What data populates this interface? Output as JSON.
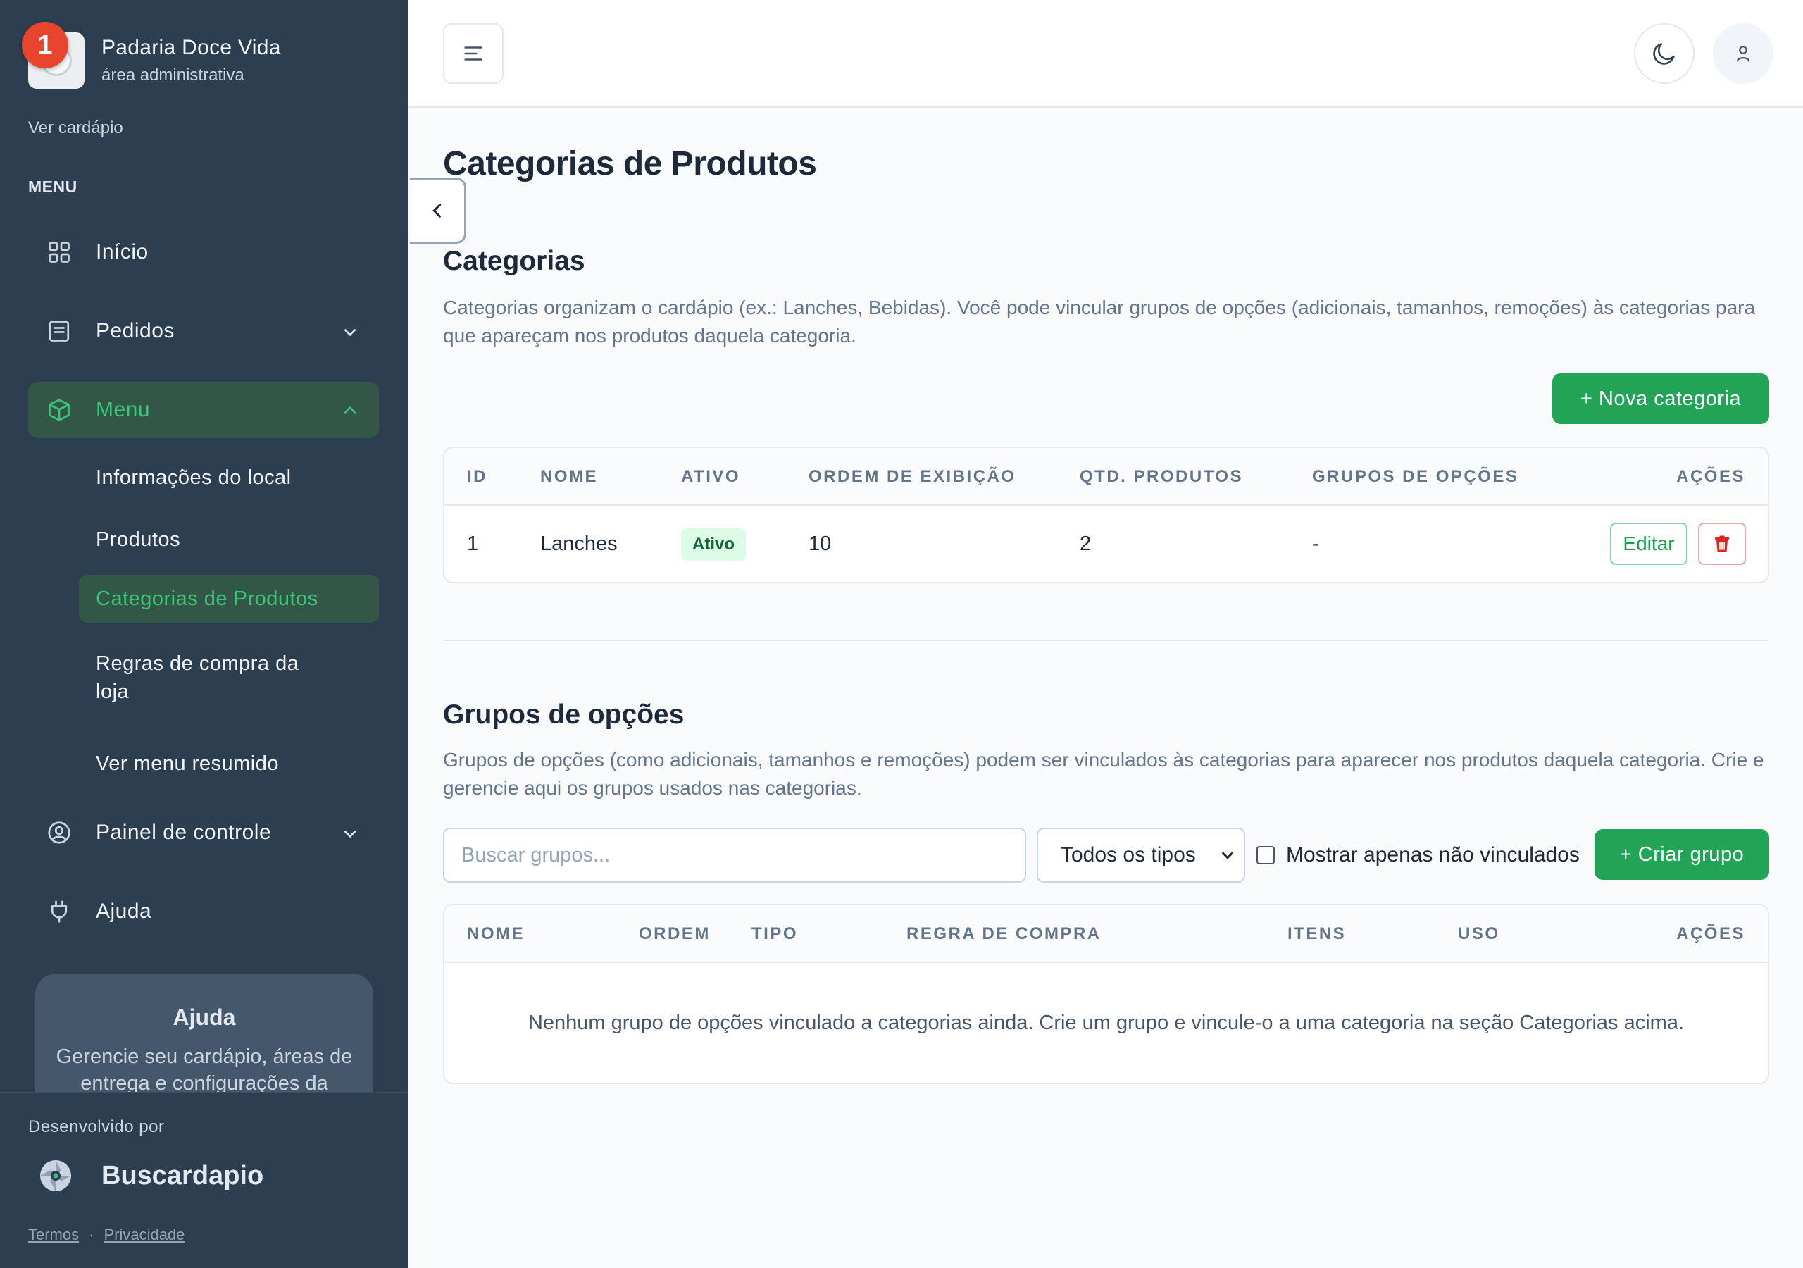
{
  "sidebar": {
    "brand": {
      "name": "Padaria Doce Vida",
      "subtitle": "área administrativa",
      "notification_count": "1"
    },
    "view_menu_link": "Ver cardápio",
    "menu_heading": "MENU",
    "nav": {
      "inicio": "Início",
      "pedidos": "Pedidos",
      "menu": "Menu",
      "painel": "Painel de controle",
      "ajuda": "Ajuda"
    },
    "menu_subitems": [
      "Informações do local",
      "Produtos",
      "Categorias de Produtos",
      "Regras de compra da loja",
      "Ver menu resumido"
    ],
    "help_card": {
      "title": "Ajuda",
      "text": "Gerencie seu cardápio, áreas de entrega e configurações da"
    },
    "developed_by": "Desenvolvido por",
    "developer_name": "Buscardapio",
    "footer": {
      "terms": "Termos",
      "separator": "·",
      "privacy": "Privacidade"
    }
  },
  "page": {
    "title": "Categorias de Produtos"
  },
  "categories": {
    "title": "Categorias",
    "description": "Categorias organizam o cardápio (ex.: Lanches, Bebidas). Você pode vincular grupos de opções (adicionais, tamanhos, remoções) às categorias para que apareçam nos produtos daquela categoria.",
    "new_button": "+ Nova categoria",
    "columns": [
      "ID",
      "NOME",
      "ATIVO",
      "ORDEM DE EXIBIÇÃO",
      "QTD. PRODUTOS",
      "GRUPOS DE OPÇÕES",
      "AÇÕES"
    ],
    "rows": [
      {
        "id": "1",
        "name": "Lanches",
        "status": "Ativo",
        "order": "10",
        "products": "2",
        "option_groups": "-",
        "edit_label": "Editar"
      }
    ]
  },
  "option_groups": {
    "title": "Grupos de opções",
    "description": "Grupos de opções (como adicionais, tamanhos e remoções) podem ser vinculados às categorias para aparecer nos produtos daquela categoria. Crie e gerencie aqui os grupos usados nas categorias.",
    "search_placeholder": "Buscar grupos...",
    "type_filter_selected": "Todos os tipos",
    "unlinked_only_label": "Mostrar apenas não vinculados",
    "unlinked_only_checked": false,
    "create_button": "+ Criar grupo",
    "columns": [
      "NOME",
      "ORDEM",
      "TIPO",
      "REGRA DE COMPRA",
      "ITENS",
      "USO",
      "AÇÕES"
    ],
    "empty_message": "Nenhum grupo de opções vinculado a categorias ainda. Crie um grupo e vincule-o a uma categoria na seção Categorias acima."
  },
  "colors": {
    "sidebar_bg": "#2d3e50",
    "accent_green": "#21a456",
    "active_nav_bg": "#335747",
    "active_nav_text": "#3cc47a",
    "danger": "#dc2626",
    "badge_red": "#e8442e"
  },
  "icons": {
    "inicio": "grid-icon",
    "pedidos": "receipt-icon",
    "menu": "box-icon",
    "painel": "user-circle-icon",
    "ajuda": "plug-icon",
    "topbar": [
      "hamburger-icon",
      "moon-icon",
      "user-icon"
    ],
    "collapse": "chevron-left-icon",
    "delete": "trash-icon"
  }
}
